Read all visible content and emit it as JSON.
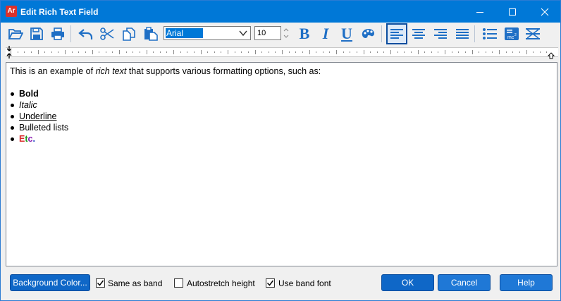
{
  "window": {
    "app_icon_text": "Ar",
    "title": "Edit Rich Text Field"
  },
  "toolbar": {
    "font_name": "Arial",
    "font_size": "10",
    "bold_label": "B",
    "italic_label": "I",
    "underline_label": "U",
    "icons": [
      "open-folder-icon",
      "save-icon",
      "print-icon",
      "undo-icon",
      "cut-icon",
      "copy-icon",
      "paste-icon",
      "bold-icon",
      "italic-icon",
      "underline-icon",
      "color-palette-icon",
      "align-left-icon",
      "align-center-icon",
      "align-right-icon",
      "justify-icon",
      "bullet-list-icon",
      "insert-formula-icon",
      "strikethrough-icon"
    ]
  },
  "editor": {
    "intro_before": "This is an example of ",
    "intro_italic": "rich text",
    "intro_after": " that supports various formatting options, such as:",
    "items": {
      "bold": "Bold",
      "italic": "Italic",
      "underline": "Underline",
      "bulleted": "Bulleted lists"
    },
    "etc_letters": [
      "E",
      "t",
      "c",
      "."
    ],
    "etc_colors": [
      "#d92b2b",
      "#1a9a1a",
      "#8a1ab0",
      "#1a3dc2"
    ]
  },
  "footer": {
    "background_color_button": "Background Color...",
    "same_as_band_label": "Same as band",
    "same_as_band_checked": true,
    "autostretch_label": "Autostretch height",
    "autostretch_checked": false,
    "use_band_font_label": "Use band font",
    "use_band_font_checked": true,
    "ok_button": "OK",
    "cancel_button": "Cancel",
    "help_button": "Help"
  },
  "colors": {
    "titlebar": "#0078d7",
    "accent": "#1f6fc5",
    "button": "#0f67c7"
  }
}
